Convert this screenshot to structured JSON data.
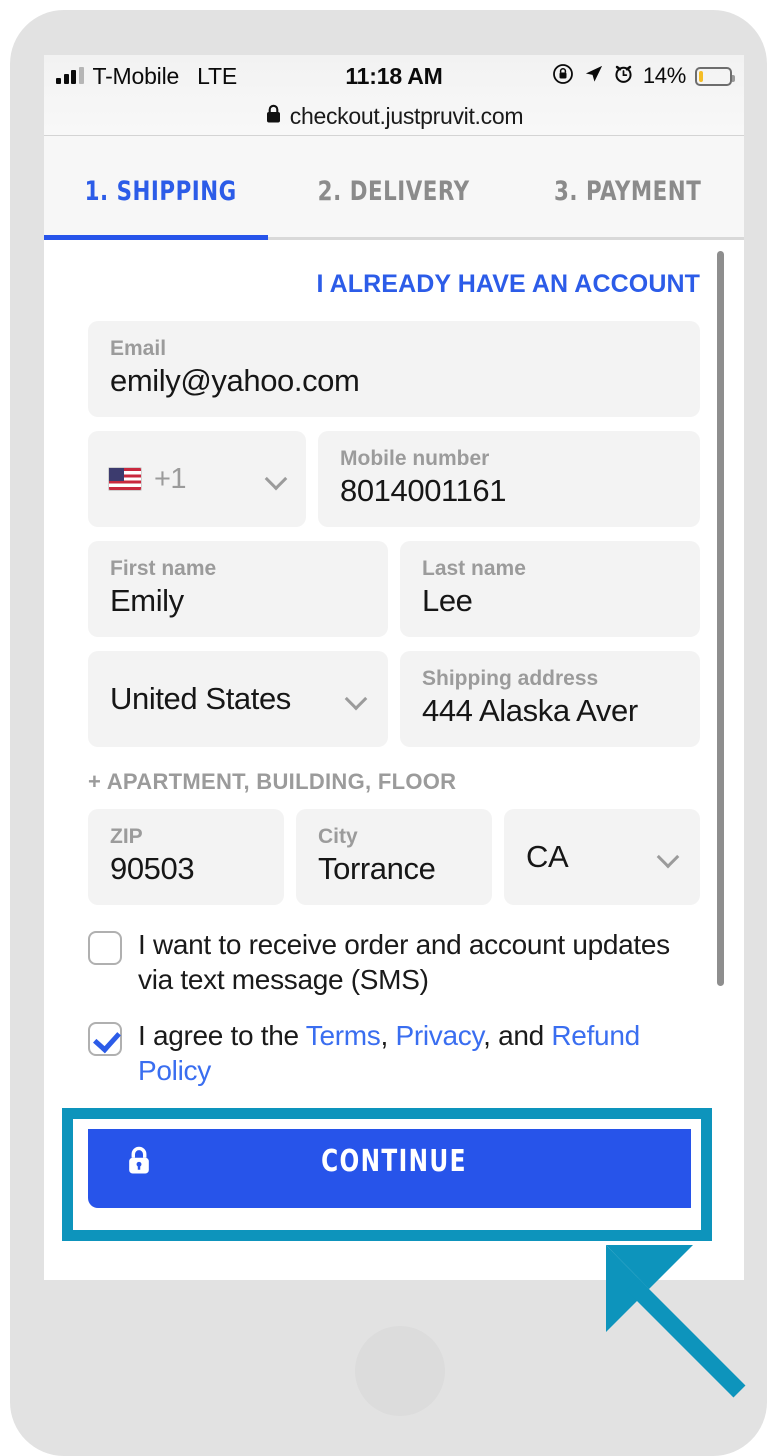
{
  "status_bar": {
    "carrier": "T-Mobile",
    "network": "LTE",
    "time": "11:18 AM",
    "battery_percent": "14%",
    "battery_level": 14,
    "icons": [
      "signal-bars-icon",
      "rotation-lock-icon",
      "location-arrow-icon",
      "alarm-clock-icon",
      "battery-icon"
    ]
  },
  "browser": {
    "url": "checkout.justpruvit.com",
    "secure_icon": "lock-icon"
  },
  "tabs": [
    {
      "label": "1. SHIPPING",
      "active": true
    },
    {
      "label": "2. DELIVERY",
      "active": false
    },
    {
      "label": "3. PAYMENT",
      "active": false
    }
  ],
  "form": {
    "account_link": "I ALREADY HAVE AN ACCOUNT",
    "email": {
      "label": "Email",
      "value": "emily@yahoo.com",
      "placeholder": "Email"
    },
    "phone_country": {
      "value": "+1",
      "flag": "us-flag-icon"
    },
    "mobile": {
      "label": "Mobile number",
      "value": "8014001161",
      "placeholder": "Mobile number"
    },
    "first_name": {
      "label": "First name",
      "value": "Emily",
      "placeholder": "First name"
    },
    "last_name": {
      "label": "Last name",
      "value": "Lee",
      "placeholder": "Last name"
    },
    "country": {
      "value": "United States"
    },
    "address": {
      "label": "Shipping address",
      "value": "444 Alaska Aver",
      "placeholder": "Shipping address"
    },
    "apartment_link": "+ APARTMENT, BUILDING, FLOOR",
    "zip": {
      "label": "ZIP",
      "value": "90503",
      "placeholder": "ZIP"
    },
    "city": {
      "label": "City",
      "value": "Torrance",
      "placeholder": "City"
    },
    "state": {
      "value": "CA"
    },
    "sms_checkbox": {
      "checked": false,
      "label": "I want to receive order and account updates via text message (SMS)"
    },
    "terms_checkbox": {
      "checked": true,
      "prefix": "I agree to the ",
      "terms_link": "Terms",
      "sep1": ", ",
      "privacy_link": "Privacy",
      "sep2": ", and ",
      "refund_link": "Refund Policy"
    },
    "continue_button": {
      "label": "CONTINUE",
      "icon": "lock-icon"
    }
  },
  "annotation": {
    "highlight_color": "#0d94bc",
    "arrow": "up-left-arrow-pointer",
    "target": "continue-button"
  },
  "colors": {
    "accent_blue": "#2754ea",
    "link_blue": "#2c5ce8",
    "field_gray": "#f3f3f3",
    "label_gray": "#9b9b9b",
    "highlight_teal": "#0d94bc",
    "battery_yellow": "#f5bd26"
  }
}
